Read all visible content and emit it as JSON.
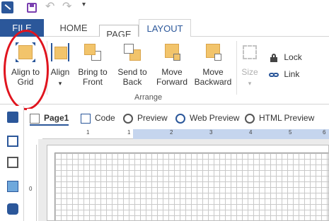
{
  "tabs": {
    "file": "FILE",
    "home": "HOME",
    "page": "PAGE",
    "layout": "LAYOUT"
  },
  "ribbon": {
    "align_to_grid": "Align to Grid",
    "align": "Align",
    "bring_to_front": "Bring to Front",
    "send_to_back": "Send to Back",
    "move_forward": "Move Forward",
    "move_backward": "Move Backward",
    "size": "Size",
    "lock": "Lock",
    "link": "Link",
    "group_label": "Arrange"
  },
  "doc_tabs": [
    "Page1",
    "Code",
    "Preview",
    "Web Preview",
    "HTML Preview"
  ],
  "ruler": {
    "h_labels": [
      "1",
      "1",
      "2",
      "3",
      "4",
      "5",
      "6"
    ],
    "v_label": "0"
  },
  "colors": {
    "accent": "#2b579a",
    "annotation": "#e0141e",
    "ruler_highlight": "#c5d5ee"
  }
}
